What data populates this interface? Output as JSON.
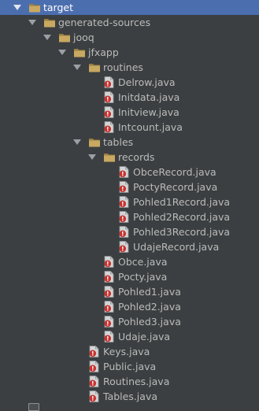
{
  "colors": {
    "background": "#3c3f41",
    "selection": "#4b6eaf",
    "text": "#bbbbbb",
    "folder": "#c9a961",
    "folder_dark": "#9b7f43",
    "java_file": "#d4d4d4",
    "error_badge": "#c7322f"
  },
  "tree": [
    {
      "label": "target",
      "icon": "folder-icon",
      "expanded": true,
      "depth": 0,
      "selected": true
    },
    {
      "label": "generated-sources",
      "icon": "folder-icon",
      "expanded": true,
      "depth": 1
    },
    {
      "label": "jooq",
      "icon": "folder-icon",
      "expanded": true,
      "depth": 2
    },
    {
      "label": "jfxapp",
      "icon": "folder-icon",
      "expanded": true,
      "depth": 3
    },
    {
      "label": "routines",
      "icon": "folder-icon",
      "expanded": true,
      "depth": 4
    },
    {
      "label": "Delrow.java",
      "icon": "java-file-error-icon",
      "depth": 5
    },
    {
      "label": "Initdata.java",
      "icon": "java-file-error-icon",
      "depth": 5
    },
    {
      "label": "Initview.java",
      "icon": "java-file-error-icon",
      "depth": 5
    },
    {
      "label": "Intcount.java",
      "icon": "java-file-error-icon",
      "depth": 5
    },
    {
      "label": "tables",
      "icon": "folder-icon",
      "expanded": true,
      "depth": 4
    },
    {
      "label": "records",
      "icon": "folder-icon",
      "expanded": true,
      "depth": 5
    },
    {
      "label": "ObceRecord.java",
      "icon": "java-file-error-icon",
      "depth": 6
    },
    {
      "label": "PoctyRecord.java",
      "icon": "java-file-error-icon",
      "depth": 6
    },
    {
      "label": "Pohled1Record.java",
      "icon": "java-file-error-icon",
      "depth": 6
    },
    {
      "label": "Pohled2Record.java",
      "icon": "java-file-error-icon",
      "depth": 6
    },
    {
      "label": "Pohled3Record.java",
      "icon": "java-file-error-icon",
      "depth": 6
    },
    {
      "label": "UdajeRecord.java",
      "icon": "java-file-error-icon",
      "depth": 6
    },
    {
      "label": "Obce.java",
      "icon": "java-file-error-icon",
      "depth": 5
    },
    {
      "label": "Pocty.java",
      "icon": "java-file-error-icon",
      "depth": 5
    },
    {
      "label": "Pohled1.java",
      "icon": "java-file-error-icon",
      "depth": 5
    },
    {
      "label": "Pohled2.java",
      "icon": "java-file-error-icon",
      "depth": 5
    },
    {
      "label": "Pohled3.java",
      "icon": "java-file-error-icon",
      "depth": 5
    },
    {
      "label": "Udaje.java",
      "icon": "java-file-error-icon",
      "depth": 5
    },
    {
      "label": "Keys.java",
      "icon": "java-file-error-icon",
      "depth": 4
    },
    {
      "label": "Public.java",
      "icon": "java-file-error-icon",
      "depth": 4
    },
    {
      "label": "Routines.java",
      "icon": "java-file-error-icon",
      "depth": 4
    },
    {
      "label": "Tables.java",
      "icon": "java-file-error-icon",
      "depth": 4
    }
  ]
}
